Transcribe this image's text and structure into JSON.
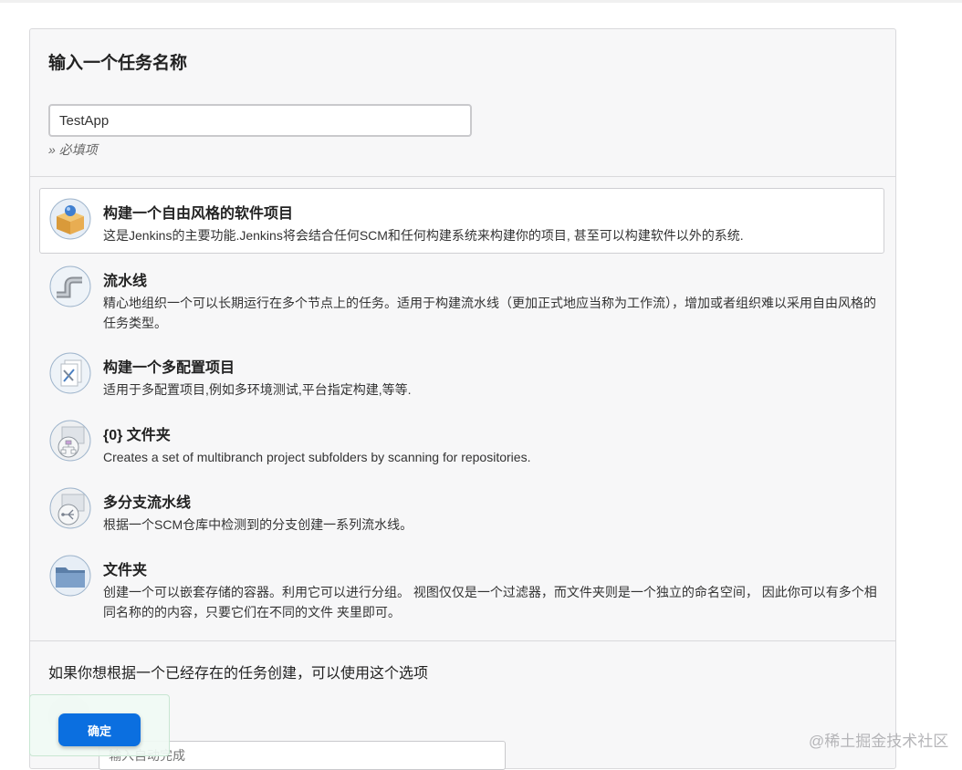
{
  "form": {
    "title": "输入一个任务名称",
    "item_name_value": "TestApp",
    "required_note": "» 必填项"
  },
  "job_types": [
    {
      "icon": "freestyle-box-icon",
      "title": "构建一个自由风格的软件项目",
      "description": "这是Jenkins的主要功能.Jenkins将会结合任何SCM和任何构建系统来构建你的项目, 甚至可以构建软件以外的系统.",
      "selected": true
    },
    {
      "icon": "pipeline-pipe-icon",
      "title": "流水线",
      "description": "精心地组织一个可以长期运行在多个节点上的任务。适用于构建流水线（更加正式地应当称为工作流），增加或者组织难以采用自由风格的任务类型。",
      "selected": false
    },
    {
      "icon": "multi-config-icon",
      "title": "构建一个多配置项目",
      "description": "适用于多配置项目,例如多环境测试,平台指定构建,等等.",
      "selected": false
    },
    {
      "icon": "org-folder-icon",
      "title": "{0} 文件夹",
      "description": "Creates a set of multibranch project subfolders by scanning for repositories.",
      "selected": false
    },
    {
      "icon": "multibranch-icon",
      "title": "多分支流水线",
      "description": "根据一个SCM仓库中检测到的分支创建一系列流水线。",
      "selected": false
    },
    {
      "icon": "folder-icon",
      "title": "文件夹",
      "description": "创建一个可以嵌套存储的容器。利用它可以进行分组。 视图仅仅是一个过滤器，而文件夹则是一个独立的命名空间， 因此你可以有多个相同名称的的内容，只要它们在不同的文件 夹里即可。",
      "selected": false
    }
  ],
  "copy_section": {
    "text": "如果你想根据一个已经存在的任务创建，可以使用这个选项",
    "input_placeholder": "输入自动完成"
  },
  "footer": {
    "ok_label": "确定"
  },
  "watermark": "@稀土掘金技术社区",
  "colors": {
    "accent": "#0b6fe0",
    "panel_bg": "#f7f7f8"
  }
}
